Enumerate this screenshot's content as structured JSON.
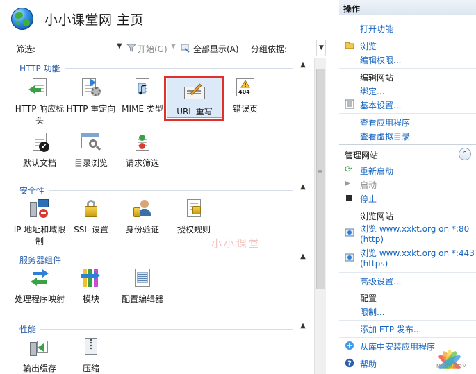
{
  "header": {
    "title": "小小课堂网 主页"
  },
  "toolbar": {
    "filter_label": "筛选:",
    "start_label": "开始(G)",
    "show_all_label": "全部显示(A)",
    "group_by_label": "分组依据:"
  },
  "sections": {
    "http": {
      "title": "HTTP 功能",
      "items": [
        {
          "label": "HTTP 响应标头",
          "icon": "http-response-headers-icon"
        },
        {
          "label": "HTTP 重定向",
          "icon": "http-redirect-icon"
        },
        {
          "label": "MIME 类型",
          "icon": "mime-types-icon"
        },
        {
          "label": "URL 重写",
          "icon": "url-rewrite-icon"
        },
        {
          "label": "错误页",
          "icon": "error-pages-icon"
        },
        {
          "label": "默认文档",
          "icon": "default-document-icon"
        },
        {
          "label": "目录浏览",
          "icon": "directory-browsing-icon"
        },
        {
          "label": "请求筛选",
          "icon": "request-filtering-icon"
        }
      ]
    },
    "security": {
      "title": "安全性",
      "items": [
        {
          "label": "IP 地址和域限制",
          "icon": "ip-domain-restrictions-icon"
        },
        {
          "label": "SSL 设置",
          "icon": "ssl-settings-icon"
        },
        {
          "label": "身份验证",
          "icon": "authentication-icon"
        },
        {
          "label": "授权规则",
          "icon": "authorization-rules-icon"
        }
      ]
    },
    "server": {
      "title": "服务器组件",
      "items": [
        {
          "label": "处理程序映射",
          "icon": "handler-mappings-icon"
        },
        {
          "label": "模块",
          "icon": "modules-icon"
        },
        {
          "label": "配置编辑器",
          "icon": "configuration-editor-icon"
        }
      ]
    },
    "performance": {
      "title": "性能",
      "items": [
        {
          "label": "输出缓存",
          "icon": "output-caching-icon"
        },
        {
          "label": "压缩",
          "icon": "compression-icon"
        }
      ]
    }
  },
  "actions": {
    "header": "操作",
    "open_feature": "打开功能",
    "browse": "浏览",
    "edit_permissions": "编辑权限...",
    "edit_site": "编辑网站",
    "bindings": "绑定...",
    "basic_settings": "基本设置...",
    "view_applications": "查看应用程序",
    "view_virtual_dirs": "查看虚拟目录",
    "manage_site": "管理网站",
    "restart": "重新启动",
    "start": "启动",
    "stop": "停止",
    "browse_site": "浏览网站",
    "browse_80_a": "浏览 www.xxkt.org on *:80",
    "browse_80_b": "(http)",
    "browse_443_a": "浏览 www.xxkt.org on *:443",
    "browse_443_b": "(https)",
    "advanced_settings": "高级设置...",
    "configure": "配置",
    "limits": "限制...",
    "add_ftp": "添加 FTP 发布...",
    "install_from_gallery": "从库中安装应用程序",
    "help": "帮助"
  },
  "watermarks": {
    "center": "小小课堂",
    "corner": "MOSU.COM"
  },
  "colors": {
    "link": "#1565c0",
    "section_title": "#2c60a8",
    "highlight": "#e0302b"
  }
}
